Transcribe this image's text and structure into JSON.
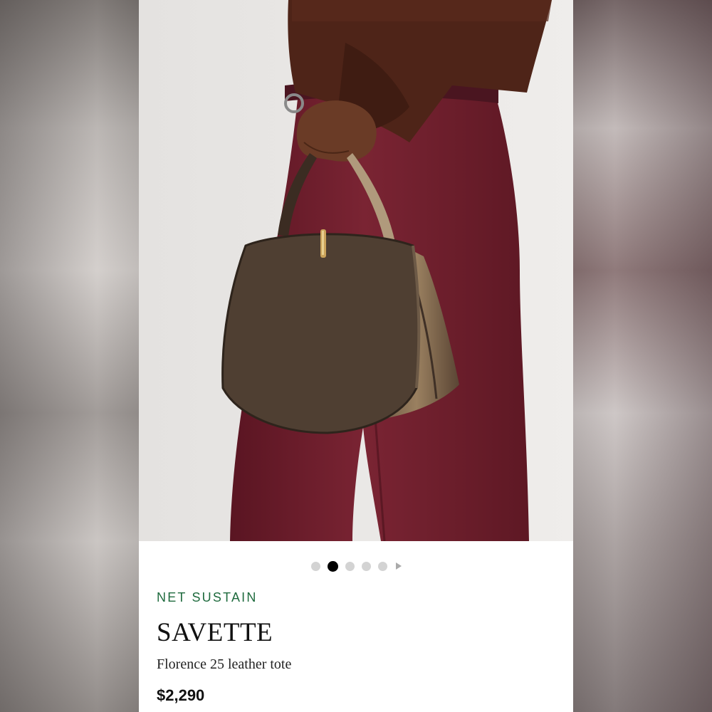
{
  "gallery": {
    "image_alt": "Florence 25 leather tote",
    "dots": [
      {
        "active": false
      },
      {
        "active": true
      },
      {
        "active": false
      },
      {
        "active": false
      },
      {
        "active": false
      }
    ]
  },
  "product": {
    "label": "NET SUSTAIN",
    "brand": "SAVETTE",
    "name": "Florence 25 leather tote",
    "price": "$2,290"
  },
  "colors": {
    "label_green": "#1f6b3e",
    "bag_brown": "#4f3f32",
    "pants_burgundy": "#6e1e2b",
    "active_dot": "#000000",
    "inactive_dot": "#d3d3d3"
  }
}
